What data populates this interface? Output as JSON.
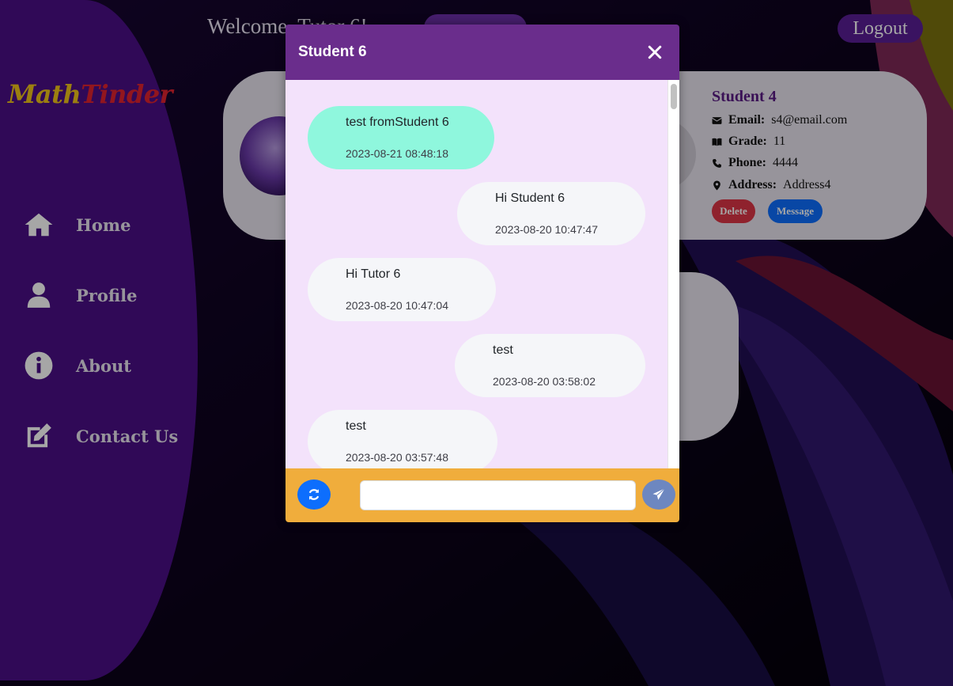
{
  "logo": {
    "part1": "Math",
    "part2": "Tinder"
  },
  "header": {
    "welcome_text": "Welcome, Tutor 6!",
    "logout_label": "Logout"
  },
  "sidebar": {
    "items": [
      {
        "label": "Home",
        "icon": "home-icon"
      },
      {
        "label": "Profile",
        "icon": "user-icon"
      },
      {
        "label": "About",
        "icon": "info-icon"
      },
      {
        "label": "Contact Us",
        "icon": "edit-icon"
      }
    ]
  },
  "student_card": {
    "name": "Student 4",
    "email_label": "Email:",
    "email": "s4@email.com",
    "grade_label": "Grade:",
    "grade": "11",
    "phone_label": "Phone:",
    "phone": "4444",
    "address_label": "Address:",
    "address": "Address4",
    "delete_label": "Delete",
    "message_label": "Message"
  },
  "chat_modal": {
    "title": "Student 6",
    "messages": [
      {
        "text": "test fromStudent 6",
        "time": "2023-08-21 08:48:18",
        "mine": true
      },
      {
        "text": "Hi Student 6",
        "time": "2023-08-20 10:47:47",
        "mine": false
      },
      {
        "text": "Hi Tutor 6",
        "time": "2023-08-20 10:47:04",
        "mine": false
      },
      {
        "text": "test",
        "time": "2023-08-20 03:58:02",
        "mine": false
      },
      {
        "text": "test",
        "time": "2023-08-20 03:57:48",
        "mine": false
      }
    ],
    "input_value": "",
    "input_placeholder": ""
  },
  "colors": {
    "sidebar": "#4a0f86",
    "modal_header": "#6a2d8c",
    "chat_background": "#f3e2fb",
    "footer": "#f0ad3c",
    "own_bubble": "#8ff7dd",
    "other_bubble": "#f5f6f9"
  }
}
